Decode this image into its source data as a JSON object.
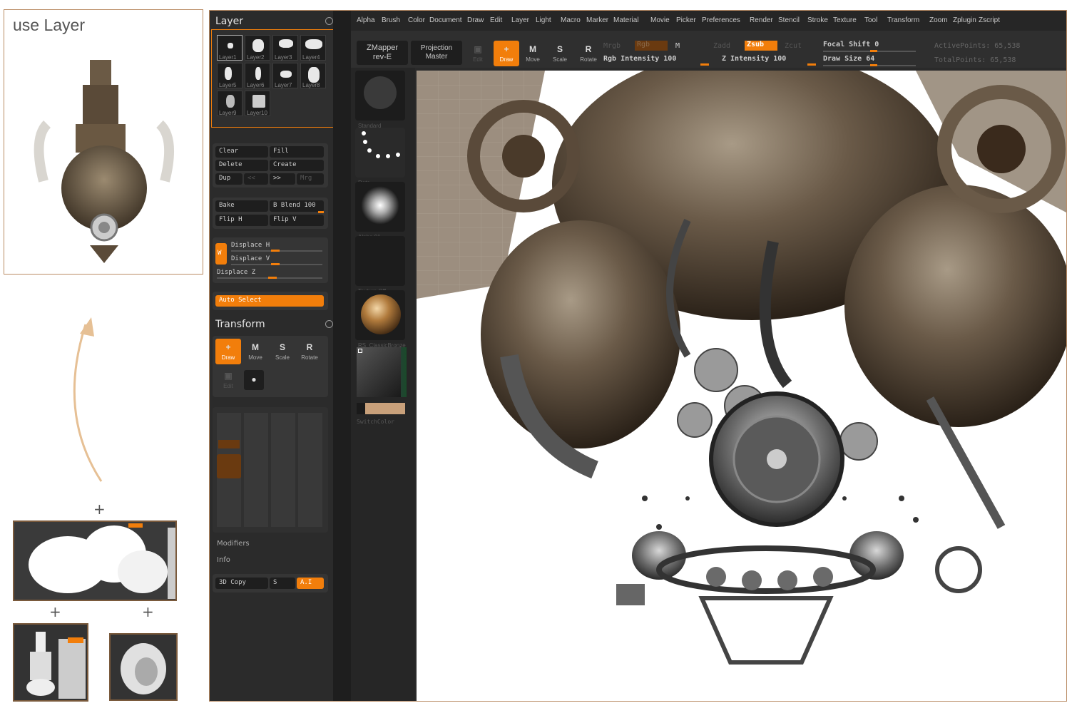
{
  "annotation": {
    "title": "use Layer",
    "plus_signs": [
      "+",
      "+",
      "+"
    ]
  },
  "menu": [
    "Alpha",
    "Brush",
    "Color",
    "Document",
    "Draw",
    "Edit",
    "Layer",
    "Light",
    "Macro",
    "Marker",
    "Material",
    "Movie",
    "Picker",
    "Preferences",
    "Render",
    "Stencil",
    "Stroke",
    "Texture",
    "Tool",
    "Transform",
    "Zoom",
    "Zplugin",
    "Zscript"
  ],
  "toolbar": {
    "zmapper_line1": "ZMapper",
    "zmapper_line2": "rev-E",
    "projection_line1": "Projection",
    "projection_line2": "Master",
    "edit": "Edit",
    "draw": "Draw",
    "move": "Move",
    "scale": "Scale",
    "rotate": "Rotate",
    "mrgb": "Mrgb",
    "rgb": "Rgb",
    "m": "M",
    "zadd": "Zadd",
    "zsub": "Zsub",
    "zcut": "Zcut",
    "rgb_intensity": "Rgb Intensity 100",
    "z_intensity": "Z Intensity 100",
    "focal_shift": "Focal Shift 0",
    "draw_size": "Draw Size 64",
    "active_points": "ActivePoints: 65,538",
    "total_points": "TotalPoints: 65,538"
  },
  "layer_panel": {
    "title": "Layer",
    "layers": [
      "Layer1",
      "Layer2",
      "Layer3",
      "Layer4",
      "Layer5",
      "Layer6",
      "Layer7",
      "Layer8",
      "Layer9",
      "Layer10"
    ],
    "clear": "Clear",
    "fill": "Fill",
    "delete": "Delete",
    "create": "Create",
    "dup": "Dup",
    "prev": "<<",
    "next": ">>",
    "mrg": "Mrg",
    "bake": "Bake",
    "b_blend": "B Blend 100",
    "flip_h": "Flip H",
    "flip_v": "Flip V",
    "w": "W",
    "displace_h": "Displace H",
    "displace_v": "Displace V",
    "displace_z": "Displace Z",
    "auto_select": "Auto Select"
  },
  "transform_panel": {
    "title": "Transform",
    "draw": "Draw",
    "move": "Move",
    "scale": "Scale",
    "rotate": "Rotate",
    "edit": "Edit",
    "modifiers": "Modifiers",
    "info": "Info",
    "copy3d": "3D Copy",
    "s": "S",
    "ai": "A.I"
  },
  "shelf": {
    "standard": "Standard",
    "dots": "Dots",
    "alpha": "Alpha 01",
    "texture": "Texture Off",
    "material": "RS_ClassicBronze",
    "switch_color": "SwitchColor"
  },
  "colors": {
    "accent": "#f27e0b",
    "frame": "#b98b63",
    "panel": "#2b2b2b"
  }
}
